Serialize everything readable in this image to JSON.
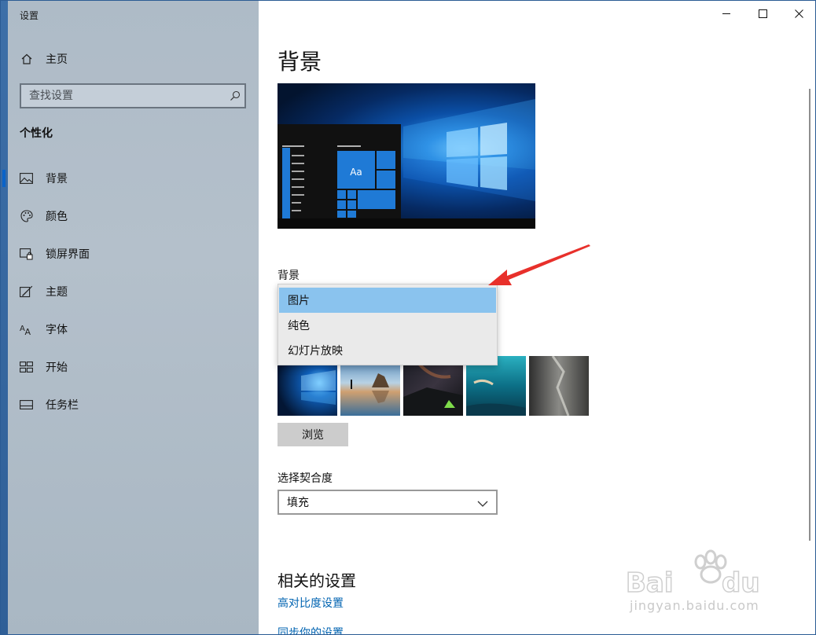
{
  "app": {
    "title": "设置"
  },
  "nav": {
    "home_label": "主页",
    "search_placeholder": "查找设置",
    "section_title": "个性化",
    "items": [
      {
        "label": "背景",
        "icon": "picture-icon",
        "selected": true
      },
      {
        "label": "颜色",
        "icon": "palette-icon",
        "selected": false
      },
      {
        "label": "锁屏界面",
        "icon": "lock-screen-icon",
        "selected": false
      },
      {
        "label": "主题",
        "icon": "theme-brush-icon",
        "selected": false
      },
      {
        "label": "字体",
        "icon": "font-icon",
        "selected": false
      },
      {
        "label": "开始",
        "icon": "start-grid-icon",
        "selected": false
      },
      {
        "label": "任务栏",
        "icon": "taskbar-icon",
        "selected": false
      }
    ]
  },
  "window_controls": {
    "minimize": "minimize-icon",
    "maximize": "maximize-icon",
    "close": "close-icon"
  },
  "main": {
    "page_title": "背景",
    "preview_tile_text": "Aa",
    "background_label": "背景",
    "background_options": [
      {
        "label": "图片",
        "selected": true
      },
      {
        "label": "纯色",
        "selected": false
      },
      {
        "label": "幻灯片放映",
        "selected": false
      }
    ],
    "thumbnails": [
      "windows-hero",
      "beach-runner",
      "night-tent",
      "underwater-swimmer",
      "rock-cliff"
    ],
    "browse_label": "浏览",
    "fit_label": "选择契合度",
    "fit_value": "填充",
    "related_title": "相关的设置",
    "related_links": [
      "高对比度设置",
      "同步你的设置"
    ]
  },
  "watermark": {
    "domain_text": "jingyan.baidu.com"
  },
  "colors": {
    "accent": "#0063b1",
    "selection": "#8ac3ee",
    "annotation": "#e8302b"
  }
}
